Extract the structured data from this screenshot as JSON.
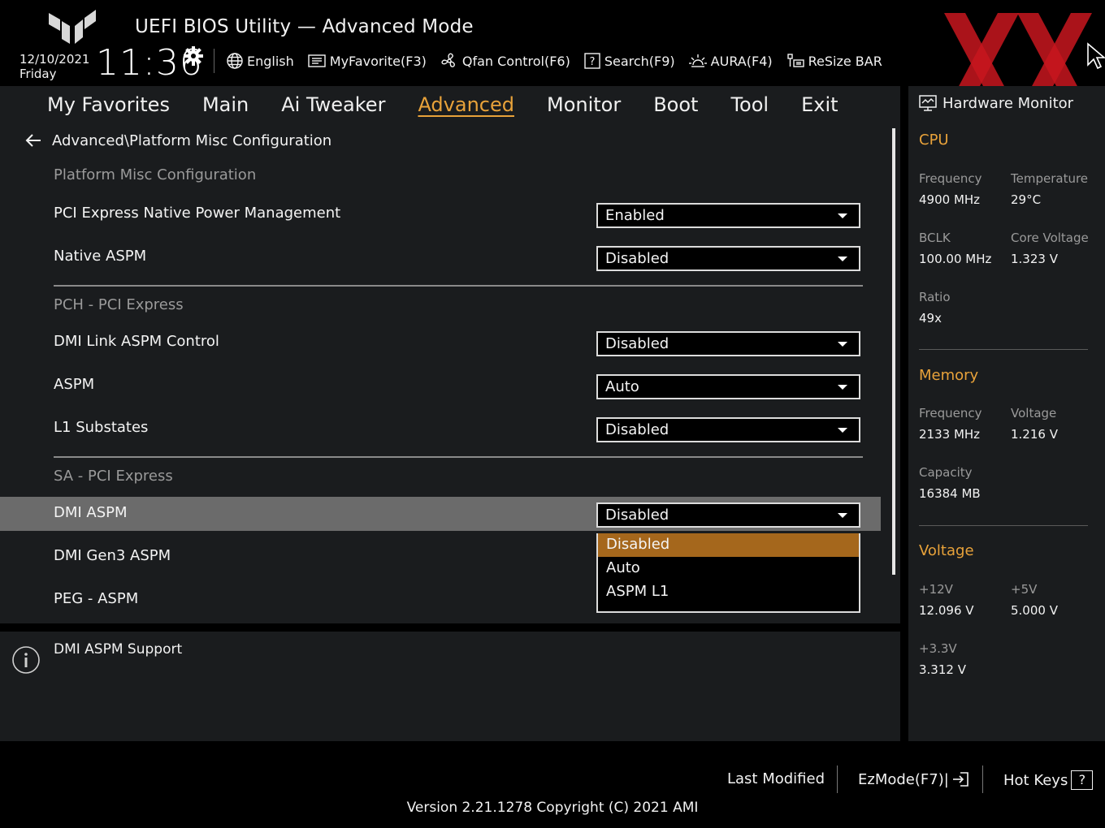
{
  "header": {
    "title": "UEFI BIOS Utility — Advanced Mode",
    "date": "12/10/2021",
    "day": "Friday",
    "time": "11:36",
    "toolbar": {
      "language": "English",
      "myfavorite": "MyFavorite(F3)",
      "qfan": "Qfan Control(F6)",
      "search": "Search(F9)",
      "aura": "AURA(F4)",
      "resizebar": "ReSize BAR"
    }
  },
  "nav": {
    "tabs": [
      "My Favorites",
      "Main",
      "Ai Tweaker",
      "Advanced",
      "Monitor",
      "Boot",
      "Tool",
      "Exit"
    ],
    "active": "Advanced"
  },
  "main": {
    "breadcrumb": "Advanced\\Platform Misc Configuration",
    "sections": {
      "platform": "Platform Misc Configuration",
      "pch": "PCH - PCI Express",
      "sa": "SA - PCI Express"
    },
    "settings": [
      {
        "label": "PCI Express Native Power Management",
        "value": "Enabled"
      },
      {
        "label": "Native ASPM",
        "value": "Disabled"
      },
      {
        "label": "DMI Link ASPM Control",
        "value": "Disabled"
      },
      {
        "label": "ASPM",
        "value": "Auto"
      },
      {
        "label": "L1 Substates",
        "value": "Disabled"
      },
      {
        "label": "DMI ASPM",
        "value": "Disabled"
      },
      {
        "label": "DMI Gen3 ASPM",
        "value": ""
      },
      {
        "label": "PEG - ASPM",
        "value": ""
      }
    ],
    "popup_options": [
      "Disabled",
      "Auto",
      "ASPM L1"
    ],
    "popup_selected": "Disabled",
    "help_text": "DMI ASPM Support"
  },
  "hardware_monitor": {
    "title": "Hardware Monitor",
    "cpu": {
      "heading": "CPU",
      "frequency_label": "Frequency",
      "frequency": "4900 MHz",
      "temperature_label": "Temperature",
      "temperature": "29°C",
      "bclk_label": "BCLK",
      "bclk": "100.00 MHz",
      "core_voltage_label": "Core Voltage",
      "core_voltage": "1.323 V",
      "ratio_label": "Ratio",
      "ratio": "49x"
    },
    "memory": {
      "heading": "Memory",
      "frequency_label": "Frequency",
      "frequency": "2133 MHz",
      "voltage_label": "Voltage",
      "voltage": "1.216 V",
      "capacity_label": "Capacity",
      "capacity": "16384 MB"
    },
    "voltage": {
      "heading": "Voltage",
      "v12_label": "+12V",
      "v12": "12.096 V",
      "v5_label": "+5V",
      "v5": "5.000 V",
      "v33_label": "+3.3V",
      "v33": "3.312 V"
    }
  },
  "footer": {
    "last_modified": "Last Modified",
    "ezmode": "EzMode(F7)|",
    "hotkeys": "Hot Keys",
    "hotkeys_glyph": "?",
    "version": "Version 2.21.1278 Copyright (C) 2021 AMI"
  },
  "colors": {
    "accent": "#e8a23a",
    "popup_selected": "#a5671c",
    "panel": "#1a1c1e",
    "selected_row": "#6b6b6b",
    "watermark": "#c8161e"
  }
}
